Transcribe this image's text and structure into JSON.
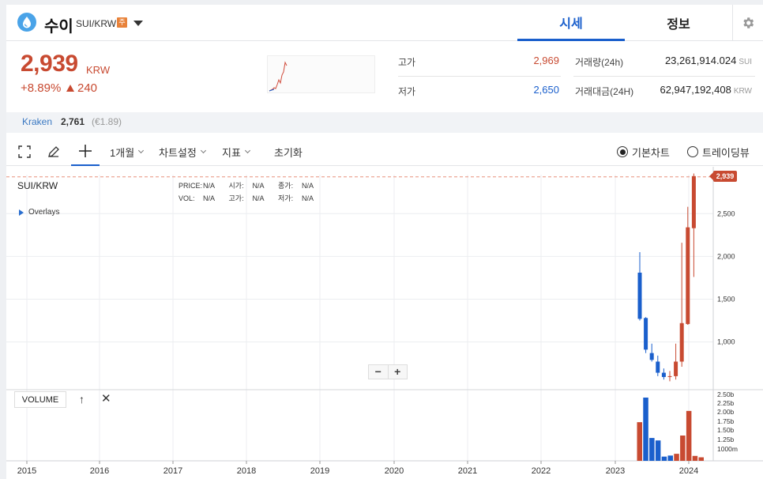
{
  "header": {
    "coin_name": "수이",
    "pair": "SUI/KRW",
    "caution_badge": "주",
    "tabs": [
      {
        "label": "시세"
      },
      {
        "label": "정보"
      }
    ]
  },
  "ticker": {
    "price": "2,939",
    "unit": "KRW",
    "change_rate": "+8.89%",
    "change_abs": "240",
    "high_label": "고가",
    "high_value": "2,969",
    "low_label": "저가",
    "low_value": "2,650",
    "volume_label": "거래량(24h)",
    "volume_value": "23,261,914.024",
    "volume_unit": "SUI",
    "turnover_label": "거래대금(24H)",
    "turnover_value": "62,947,192,408",
    "turnover_unit": "KRW"
  },
  "exchange": {
    "name": "Kraken",
    "price": "2,761",
    "eur": "(€1.89)"
  },
  "toolbar": {
    "period": "1개월",
    "chart_settings": "차트설정",
    "indicators": "지표",
    "reset": "초기화",
    "basic_chart": "기본차트",
    "tradingview": "트레이딩뷰"
  },
  "chart": {
    "pair": "SUI/KRW",
    "overlays": "Overlays",
    "legend": {
      "price_k": "PRICE:",
      "price_v": "N/A",
      "open_k": "시가:",
      "open_v": "N/A",
      "close_k": "종가:",
      "close_v": "N/A",
      "vol_k": "VOL:",
      "vol_v": "N/A",
      "high_k": "고가:",
      "high_v": "N/A",
      "low_k": "저가:",
      "low_v": "N/A"
    },
    "zoom_out": "−",
    "zoom_in": "+",
    "volume_label": "VOLUME",
    "last_price_tag": "2,939"
  },
  "chart_data": {
    "type": "candlestick",
    "x_ticks": [
      "2015",
      "2016",
      "2017",
      "2018",
      "2019",
      "2020",
      "2021",
      "2022",
      "2023",
      "2024"
    ],
    "y_ticks": [
      "2,500",
      "2,000",
      "1,500",
      "1,000"
    ],
    "vol_ticks": [
      "2.50b",
      "2.25b",
      "2.00b",
      "1.75b",
      "1.50b",
      "1.25b",
      "1000m"
    ],
    "candles": [
      {
        "o": 1810,
        "c": 1270,
        "h": 2050,
        "l": 1250
      },
      {
        "o": 1280,
        "c": 910,
        "h": 1290,
        "l": 870
      },
      {
        "o": 870,
        "c": 790,
        "h": 980,
        "l": 770
      },
      {
        "o": 770,
        "c": 640,
        "h": 840,
        "l": 600
      },
      {
        "o": 640,
        "c": 590,
        "h": 690,
        "l": 560
      },
      {
        "o": 590,
        "c": 600,
        "h": 660,
        "l": 540
      },
      {
        "o": 600,
        "c": 770,
        "h": 980,
        "l": 560
      },
      {
        "o": 770,
        "c": 1220,
        "h": 2160,
        "l": 710
      },
      {
        "o": 1210,
        "c": 2340,
        "h": 2580,
        "l": 1200
      },
      {
        "o": 2330,
        "c": 2939,
        "h": 2969,
        "l": 1760
      }
    ],
    "volumes": [
      1.1,
      1.8,
      0.65,
      0.58,
      0.12,
      0.15,
      0.2,
      0.72,
      1.42,
      0.14,
      0.1
    ],
    "vol_colors": [
      "#c84a31",
      "#1a5fcc",
      "#1a5fcc",
      "#1a5fcc",
      "#1a5fcc",
      "#1a5fcc",
      "#c84a31",
      "#c84a31",
      "#c84a31",
      "#c84a31",
      "#c84a31"
    ],
    "colors": {
      "up": "#c84a31",
      "down": "#1a5fcc"
    }
  }
}
